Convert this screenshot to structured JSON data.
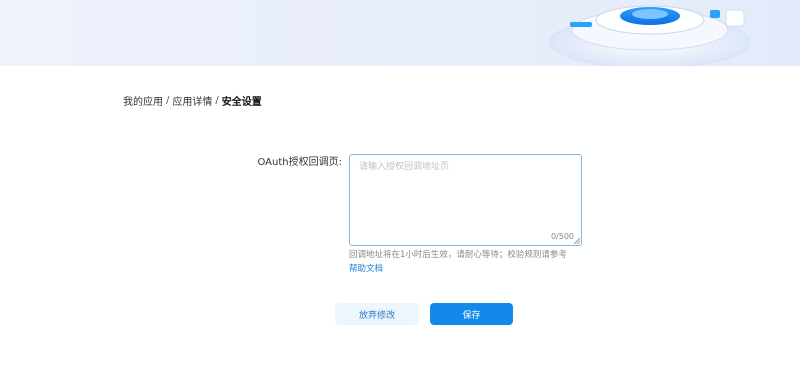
{
  "breadcrumb": {
    "items": [
      "我的应用",
      "应用详情"
    ],
    "separator": "/",
    "current": "安全设置"
  },
  "form": {
    "oauth_label": "OAuth授权回调页:",
    "oauth_placeholder": "请输入授权回调地址页",
    "oauth_value": "",
    "counter": "0/500",
    "hint": "回调地址将在1小时后生效，请耐心等待；校验规则请参考",
    "help_link": "帮助文档"
  },
  "actions": {
    "cancel_label": "放弃修改",
    "save_label": "保存"
  },
  "colors": {
    "accent": "#1389ea",
    "link": "#1a7fd6",
    "banner": "#e8eefb"
  }
}
